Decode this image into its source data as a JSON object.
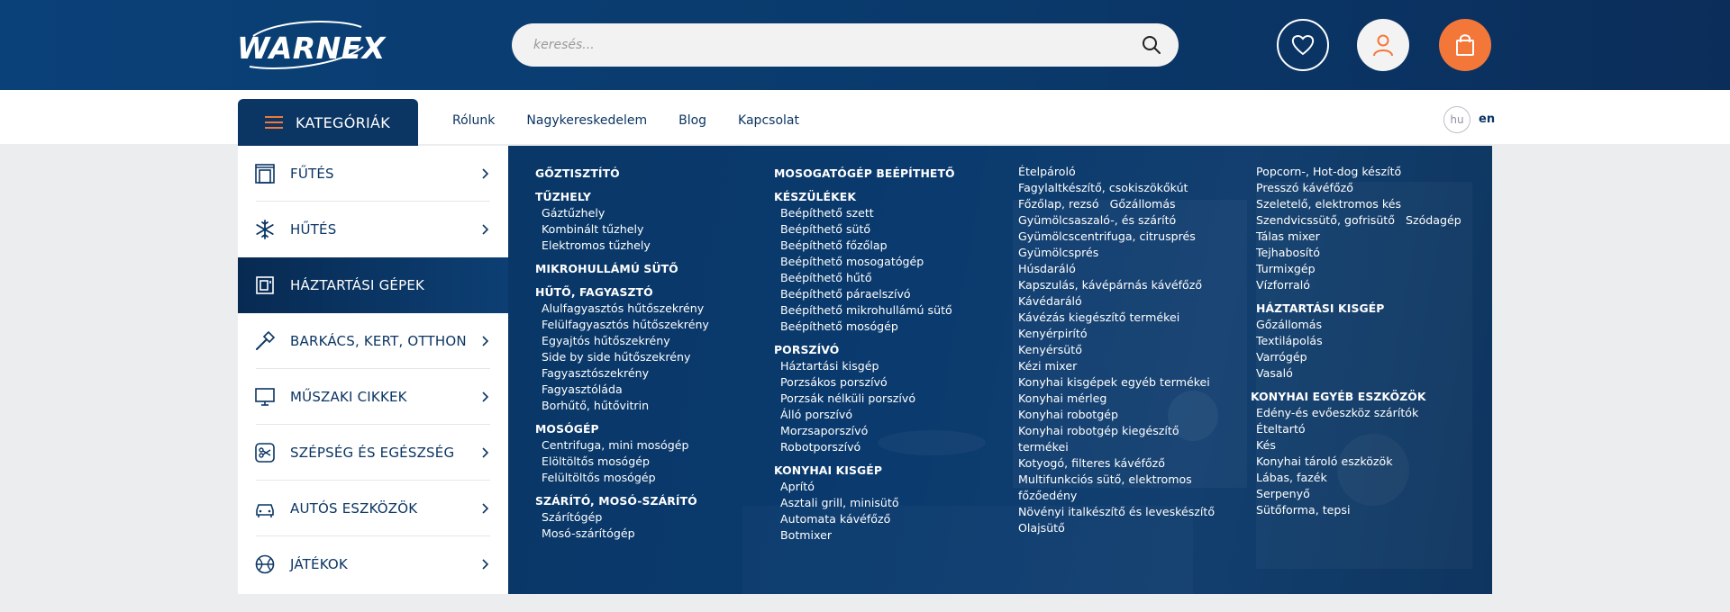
{
  "header": {
    "logo_text": "WARNEX",
    "search_placeholder": "keresés..."
  },
  "nav": {
    "categories_label": "KATEGÓRIÁK",
    "links": [
      "Rólunk",
      "Nagykereskedelem",
      "Blog",
      "Kapcsolat"
    ],
    "lang_hu": "hu",
    "lang_en": "en"
  },
  "sidebar": {
    "items": [
      {
        "label": "FŰTÉS",
        "icon": "heater-icon"
      },
      {
        "label": "HŰTÉS",
        "icon": "snowflake-icon"
      },
      {
        "label": "HÁZTARTÁSI GÉPEK",
        "icon": "appliance-icon",
        "active": true
      },
      {
        "label": "BARKÁCS, KERT, OTTHON",
        "icon": "hammer-icon"
      },
      {
        "label": "MŰSZAKI CIKKEK",
        "icon": "monitor-icon"
      },
      {
        "label": "SZÉPSÉG ÉS EGÉSZSÉG",
        "icon": "scissors-icon"
      },
      {
        "label": "AUTÓS ESZKÖZÖK",
        "icon": "car-icon"
      },
      {
        "label": "JÁTÉKOK",
        "icon": "ball-icon"
      }
    ]
  },
  "mega": {
    "col1": {
      "h1": "GŐZTISZTÍTÓ",
      "h2": "TŰZHELY",
      "tuzhely": [
        "Gáztűzhely",
        "Kombinált tűzhely",
        "Elektromos tűzhely"
      ],
      "h3": "MIKROHULLÁMÚ SÜTŐ",
      "h4": "HŰTŐ, FAGYASZTÓ",
      "huto": [
        "Alulfagyasztós hűtőszekrény",
        "Felülfagyasztós hűtőszekrény",
        "Egyajtós hűtőszekrény",
        "Side by side hűtőszekrény",
        "Fagyasztószekrény",
        "Fagyasztóláda",
        "Borhűtő, hűtővitrin"
      ],
      "h5": "MOSÓGÉP",
      "moso": [
        "Centrifuga, mini mosógép",
        "Elöltöltős mosógép",
        "Felültöltős mosógép"
      ],
      "h6": "SZÁRÍTÓ, MOSÓ-SZÁRÍTÓ",
      "szarito": [
        "Szárítógép",
        "Mosó-szárítógép"
      ]
    },
    "col2": {
      "h1a": "MOSOGATÓGÉP BEÉPÍTHETŐ",
      "h1b": "KÉSZÜLÉKEK",
      "beep": [
        "Beépíthető szett",
        "Beépíthető sütő",
        "Beépíthető főzőlap",
        "Beépíthető mosogatógép",
        "Beépíthető hűtő",
        "Beépíthető páraelszívó",
        "Beépíthető mikrohullámú sütő",
        "Beépíthető mosógép"
      ],
      "h2": "PORSZÍVÓ",
      "porszivo": [
        "Háztartási kisgép",
        "Porzsákos porszívó",
        "Porzsák nélküli porszívó",
        "Álló porszívó",
        "Morzsaporszívó",
        "Robotporszívó"
      ],
      "h3": "KONYHAI KISGÉP",
      "konyhai": [
        "Aprító",
        "Asztali grill, minisütő",
        "Automata kávéfőző",
        "Botmixer"
      ]
    },
    "col3": {
      "items": [
        "Ételpároló",
        "Fagylaltkészítő, csokiszökőkút",
        "Főzőlap, rezsó   Gőzállomás",
        "Gyümölcsaszaló-, és szárító",
        "Gyümölcscentrifuga, citrusprés",
        "Gyümölcsprés",
        "Húsdaráló",
        "Kapszulás, kávépárnás kávéfőző",
        "Kávédaráló",
        "Kávézás kiegészítő termékei",
        "Kenyérpirító",
        "Kenyérsütő",
        "Kézi mixer",
        "Konyhai kisgépek egyéb termékei",
        "Konyhai mérleg",
        "Konyhai robotgép",
        "Konyhai robotgép kiegészítő",
        "termékei",
        "Kotyogó, filteres kávéfőző",
        "Multifunkciós sütő, elektromos",
        "főzőedény",
        "Növényi italkészítő és leveskészítő",
        "Olajsütő"
      ]
    },
    "col4": {
      "items": [
        "Popcorn-, Hot-dog készítő",
        "Presszó kávéfőző",
        "Szeletelő, elektromos kés",
        "Szendvicssütő, gofrisütő   Szódagép",
        "Tálas mixer",
        "Tejhabosító",
        "Turmixgép",
        "Vízforraló"
      ],
      "h2": "HÁZTARTÁSI KISGÉP",
      "kisgep": [
        "Gőzállomás",
        "Textilápolás",
        "Varrógép",
        "Vasaló"
      ],
      "h3": "KONYHAI EGYÉB ESZKÖZÖK",
      "egyeb": [
        "Edény-és evőeszköz szárítók",
        "Ételtartó",
        "Kés",
        "Konyhai tároló eszközök",
        "Lábas, fazék",
        "Serpenyő",
        "Sütőforma, tepsi"
      ]
    }
  }
}
